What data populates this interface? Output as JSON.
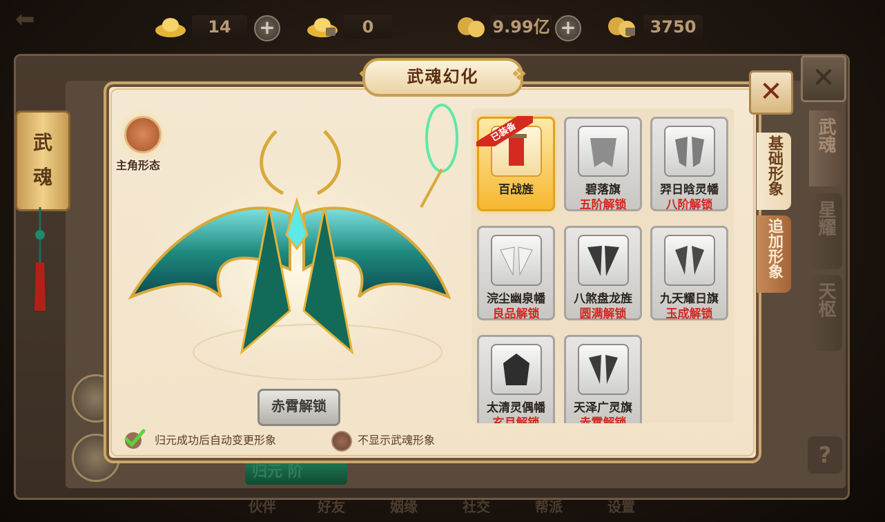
{
  "topbar": {
    "gold_ingot": "14",
    "locked_ingot": "0",
    "coins": "9.99亿",
    "locked_coins": "3750"
  },
  "left_scroll": {
    "line1": "武",
    "line2": "魂"
  },
  "title": "武魂幻化",
  "avatar_label": "主角形态",
  "unlock_button": "赤霄解锁",
  "options": {
    "auto_change": "归元成功后自动变更形象",
    "hide_soul": "不显示武魂形象"
  },
  "equipped_badge": "已装备",
  "items": [
    {
      "name": "百战旌",
      "req": "",
      "selected": true,
      "icon": "red-banner-icon"
    },
    {
      "name": "碧落旗",
      "req": "五阶解锁",
      "selected": false,
      "icon": "gray-cape-icon"
    },
    {
      "name": "羿日晗灵幡",
      "req": "八阶解锁",
      "selected": false,
      "icon": "gray-cape-icon"
    },
    {
      "name": "浣尘幽泉幡",
      "req": "良品解锁",
      "selected": false,
      "icon": "white-wings-icon"
    },
    {
      "name": "八煞盘龙旌",
      "req": "圆满解锁",
      "selected": false,
      "icon": "dark-wings-icon"
    },
    {
      "name": "九天耀日旗",
      "req": "玉成解锁",
      "selected": false,
      "icon": "dark-wings-icon"
    },
    {
      "name": "太清灵偶幡",
      "req": "玄月解锁",
      "selected": false,
      "icon": "dark-demon-icon"
    },
    {
      "name": "天泽广灵旗",
      "req": "赤霄解锁",
      "selected": false,
      "icon": "dark-wings-icon"
    }
  ],
  "panel_tabs": [
    {
      "label": "基础形象",
      "active": true
    },
    {
      "label": "追加形象",
      "active": false
    }
  ],
  "outer_tabs": [
    {
      "label": "武魂",
      "active": true
    },
    {
      "label": "星耀",
      "active": false
    },
    {
      "label": "天枢",
      "active": false
    }
  ],
  "help": "?",
  "greenbar": "归元  阶",
  "bottom_nav": [
    "伙伴",
    "好友",
    "姻缘",
    "社交",
    "帮派",
    "设置"
  ],
  "colors": {
    "accent_red": "#d22820",
    "gold": "#f6b830",
    "panel_bg": "#f5e8d2"
  }
}
